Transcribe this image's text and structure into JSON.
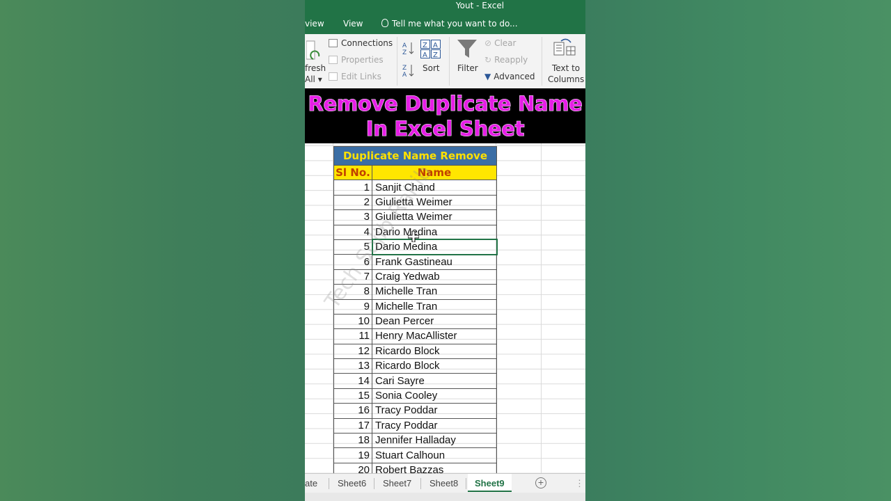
{
  "window": {
    "title": "Yout - Excel"
  },
  "ribbon_tabs": {
    "review": "view",
    "view": "View",
    "tell_me": "Tell me what you want to do..."
  },
  "ribbon": {
    "refresh": "fresh",
    "refresh_all": "All",
    "connections": "Connections",
    "properties": "Properties",
    "edit_links": "Edit Links",
    "sort": "Sort",
    "filter": "Filter",
    "clear": "Clear",
    "reapply": "Reapply",
    "advanced": "Advanced",
    "text_to": "Text to",
    "columns": "Columns"
  },
  "banner": {
    "line1": "Remove Duplicate Name",
    "line2": "In Excel Sheet"
  },
  "table": {
    "title": "Duplicate Name Remove",
    "col_no": "Sl No.",
    "col_name": "Name",
    "rows": [
      {
        "no": "1",
        "name": "Sanjit Chand"
      },
      {
        "no": "2",
        "name": "Giulietta Weimer"
      },
      {
        "no": "3",
        "name": "Giulietta Weimer"
      },
      {
        "no": "4",
        "name": "Dario Medina"
      },
      {
        "no": "5",
        "name": "Dario Medina"
      },
      {
        "no": "6",
        "name": "Frank Gastineau"
      },
      {
        "no": "7",
        "name": "Craig Yedwab"
      },
      {
        "no": "8",
        "name": "Michelle Tran"
      },
      {
        "no": "9",
        "name": "Michelle Tran"
      },
      {
        "no": "10",
        "name": "Dean Percer"
      },
      {
        "no": "11",
        "name": "Henry MacAllister"
      },
      {
        "no": "12",
        "name": "Ricardo Block"
      },
      {
        "no": "13",
        "name": "Ricardo Block"
      },
      {
        "no": "14",
        "name": "Cari Sayre"
      },
      {
        "no": "15",
        "name": "Sonia Cooley"
      },
      {
        "no": "16",
        "name": "Tracy Poddar"
      },
      {
        "no": "17",
        "name": "Tracy Poddar"
      },
      {
        "no": "18",
        "name": "Jennifer Halladay"
      },
      {
        "no": "19",
        "name": "Stuart Calhoun"
      },
      {
        "no": "20",
        "name": "Robert Bazzas"
      }
    ],
    "selected_row": 5
  },
  "watermark": "Tech Sojib Rakib",
  "sheets": {
    "tabs": [
      "ate",
      "Sheet6",
      "Sheet7",
      "Sheet8",
      "Sheet9"
    ],
    "active": "Sheet9",
    "add": "+"
  },
  "colors": {
    "excel_green": "#217346",
    "banner_magenta": "#e61ee6",
    "header_blue": "#3b6ea5",
    "header_yellow": "#ffe600"
  }
}
